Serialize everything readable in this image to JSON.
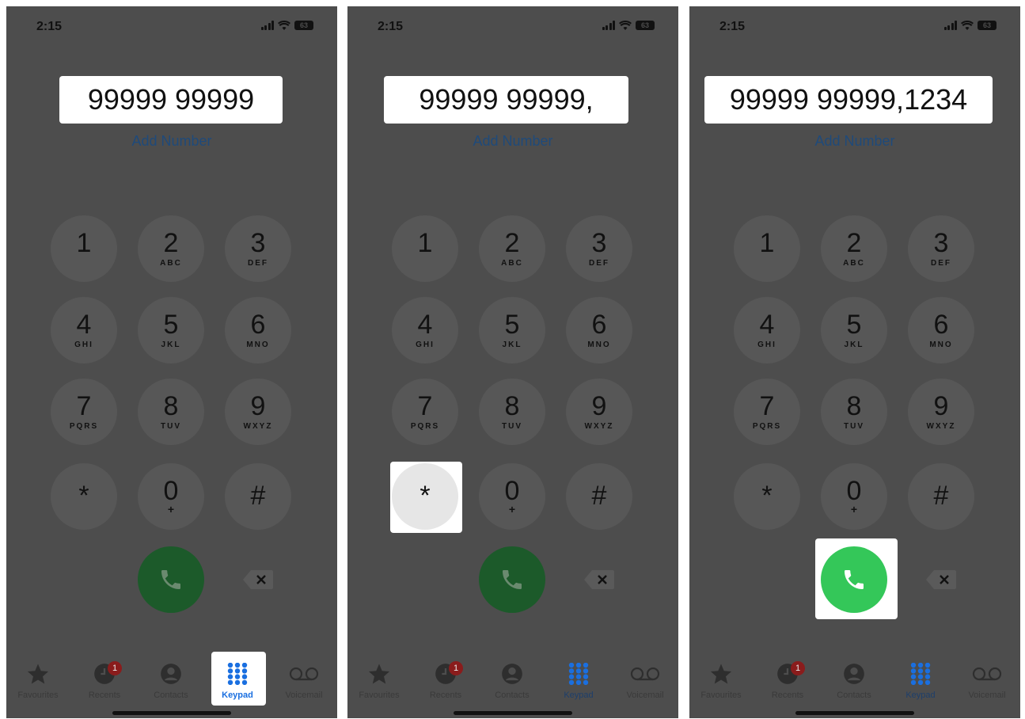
{
  "colors": {
    "panel_bg": "#4d4d4d",
    "call_green": "#34c759",
    "call_green_dimmed": "#1c5a2a",
    "link_blue": "#1f4a7a",
    "badge_red": "#8a1c1c"
  },
  "status_bar": {
    "time": "2:15",
    "battery": "63"
  },
  "add_number_label": "Add Number",
  "keys": [
    {
      "digit": "1",
      "letters": ""
    },
    {
      "digit": "2",
      "letters": "ABC"
    },
    {
      "digit": "3",
      "letters": "DEF"
    },
    {
      "digit": "4",
      "letters": "GHI"
    },
    {
      "digit": "5",
      "letters": "JKL"
    },
    {
      "digit": "6",
      "letters": "MNO"
    },
    {
      "digit": "7",
      "letters": "PQRS"
    },
    {
      "digit": "8",
      "letters": "TUV"
    },
    {
      "digit": "9",
      "letters": "WXYZ"
    },
    {
      "digit": "*",
      "letters": ""
    },
    {
      "digit": "0",
      "letters": "+"
    },
    {
      "digit": "#",
      "letters": ""
    }
  ],
  "tabs": [
    {
      "label": "Favourites",
      "icon": "star-icon"
    },
    {
      "label": "Recents",
      "icon": "clock-icon",
      "badge": "1"
    },
    {
      "label": "Contacts",
      "icon": "person-icon"
    },
    {
      "label": "Keypad",
      "icon": "keypad-grid-icon"
    },
    {
      "label": "Voicemail",
      "icon": "voicemail-icon"
    }
  ],
  "screens": [
    {
      "number": "99999 99999",
      "highlight": "keypad-tab"
    },
    {
      "number": "99999 99999,",
      "highlight": "star-key"
    },
    {
      "number": "99999 99999,1234",
      "highlight": "call-button"
    }
  ]
}
